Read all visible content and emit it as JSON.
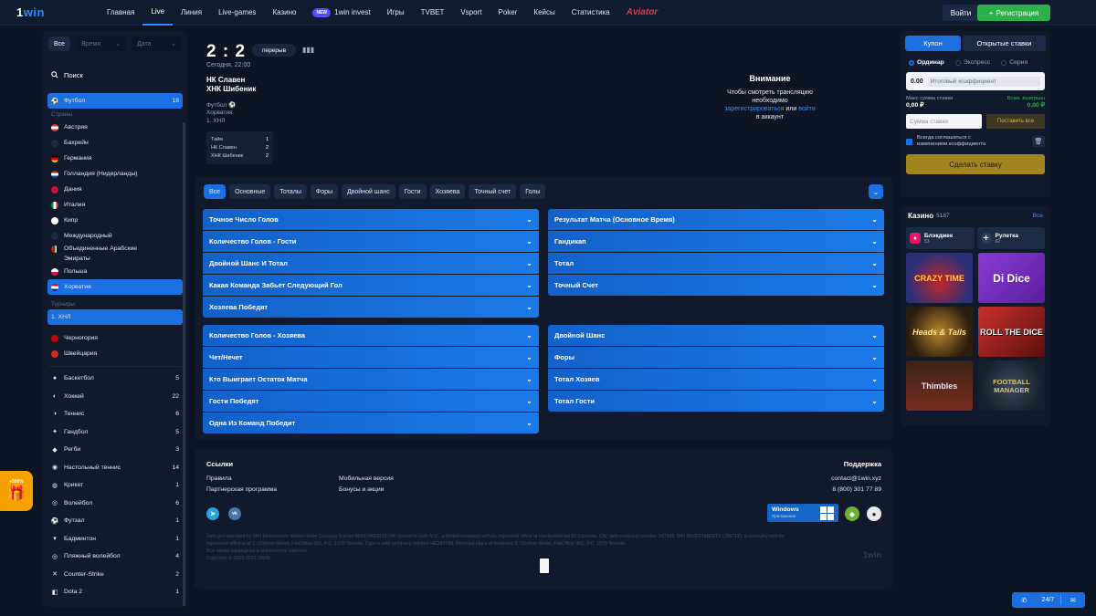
{
  "brand": {
    "logo_prefix": "1",
    "logo_suffix": "win"
  },
  "nav": {
    "items": [
      "Главная",
      "Live",
      "Линия",
      "Live-games",
      "Казино",
      "1win invest",
      "Игры",
      "TVBET",
      "Vsport",
      "Poker",
      "Кейсы",
      "Статистика"
    ],
    "new_badge": "NEW",
    "aviator": "Aviator",
    "login": "Войти",
    "register": "Регистрация"
  },
  "sidebar": {
    "filters": {
      "all": "Все",
      "time": "Время",
      "date": "Дата"
    },
    "search": "Поиск",
    "football": {
      "label": "Футбол",
      "count": "18"
    },
    "countries_label": "Страны",
    "countries": [
      "Австрия",
      "Бахрейн",
      "Германия",
      "Голландия (Нидерланды)",
      "Дания",
      "Италия",
      "Кипр",
      "Международный",
      "Объединенные Арабские",
      "Эмираты",
      "Польша",
      "Хорватия"
    ],
    "tournaments_label": "Турниры",
    "tournament": "1. ХНЛ",
    "more_countries": [
      "Черногория",
      "Швейцария"
    ],
    "sports": [
      {
        "label": "Баскетбол",
        "count": "5"
      },
      {
        "label": "Хоккей",
        "count": "22"
      },
      {
        "label": "Теннис",
        "count": "6"
      },
      {
        "label": "Гандбол",
        "count": "5"
      },
      {
        "label": "Регби",
        "count": "3"
      },
      {
        "label": "Настольный теннис",
        "count": "14"
      },
      {
        "label": "Крикет",
        "count": "1"
      },
      {
        "label": "Волейбол",
        "count": "6"
      },
      {
        "label": "Футзал",
        "count": "1"
      },
      {
        "label": "Бадминтон",
        "count": "1"
      },
      {
        "label": "Пляжный волейбол",
        "count": "4"
      },
      {
        "label": "Counter-Strike",
        "count": "2"
      },
      {
        "label": "Dota 2",
        "count": "1"
      }
    ]
  },
  "gift": {
    "percent": "+500%"
  },
  "match": {
    "score": "2 : 2",
    "status": "перерыв",
    "date": "Сегодня, 22:00",
    "team1": "НК Славен",
    "team2": "ХНК Шибеник",
    "sport": "Футбол",
    "country": "Хорватия",
    "league": "1. ХНЛ",
    "table": {
      "header": "Тайм",
      "header_val": "1",
      "row1": "НК Славен",
      "row1_val": "2",
      "row2": "ХНК Шибеник",
      "row2_val": "2"
    },
    "attention": {
      "title": "Внимание",
      "line1": "Чтобы смотреть трансляцию",
      "line2": "необходимо",
      "link_register": "зарегистрироваться",
      "or": "или",
      "link_login": "войти",
      "line3": "в аккаунт"
    }
  },
  "markets": {
    "chips": [
      "Все",
      "Основные",
      "Тоталы",
      "Форы",
      "Двойной шанс",
      "Гости",
      "Хозяева",
      "Точный счет",
      "Голы"
    ],
    "left_group1": [
      "Точное Число Голов",
      "Количество Голов - Гости",
      "Двойной Шанс И Тотал",
      "Какая Команда Забьет Следующий Гол",
      "Хозяева Победят"
    ],
    "right_group1": [
      "Результат Матча (Основное Время)",
      "Гандикап",
      "Тотал",
      "Точный Счет"
    ],
    "left_group2": [
      "Количество Голов - Хозяева",
      "Чет/Нечет",
      "Кто Выиграет Остаток Матча",
      "Гости Победят",
      "Одна Из Команд Победит"
    ],
    "right_group2": [
      "Двойной Шанс",
      "Форы",
      "Тотал Хозяев",
      "Тотал Гости"
    ]
  },
  "footer": {
    "links_title": "Ссылки",
    "rules": "Правила",
    "partners": "Партнерская программа",
    "mobile": "Мобильная версия",
    "bonuses": "Бонусы и акции",
    "support_title": "Поддержка",
    "email": "contact@1win.xyz",
    "phone": "8 (800) 301 77 89",
    "windows": "Windows",
    "windows_sub": "Приложение",
    "legal1": "1win.pro operated by MFI Investments limited under Curaçao license 8048/JAZ2018-040 issued to 1win N.V., a limited company with its registered office at Heelsumstraat 51 Curacao, CW, with company number 147039. MFI INVESTMENTS LIMITED, a company with its",
    "legal2": "registered office is at 2, Chytron Street, FlatOffice 301, P.C. 1075 Nicosia, Cyprus with company number HE386738. Principal place of business 3, Chytron Street, FlatOffice 301, P.C. 1075 Nicosia",
    "legal3": "Все права защищены и охраняются законом.",
    "legal4": "Copyright © 2016-2021 1WIN",
    "brand": "1win"
  },
  "coupon": {
    "tab_coupon": "Купон",
    "tab_open": "Открытые ставки",
    "radio_single": "Ординар",
    "radio_express": "Экспресс",
    "radio_series": "Серия",
    "coef_value": "0.00",
    "coef_label": "Итоговый коэффициент",
    "max_label": "Макс сумма ставки",
    "max_value": "0,00 ₽",
    "win_label": "Возм. выигрыш",
    "win_value": "0,00 ₽",
    "stake_placeholder": "Сумма ставки",
    "stake_all": "Поставить все",
    "agree1": "Всегда соглашаться с",
    "agree2": "изменением коэффициента",
    "make_bet": "Сделать ставку"
  },
  "casino": {
    "title": "Казино",
    "count": "5187",
    "all": "Все",
    "blackjack": {
      "label": "Блэкджек",
      "count": "53"
    },
    "roulette": {
      "label": "Рулетка",
      "count": "62"
    },
    "games": [
      "CRAZY TIME",
      "Di Dice",
      "Heads & Tails",
      "ROLL THE DICE",
      "Thimbles",
      "FOOTBALL MANAGER"
    ]
  },
  "chat": {
    "support": "24/7"
  }
}
